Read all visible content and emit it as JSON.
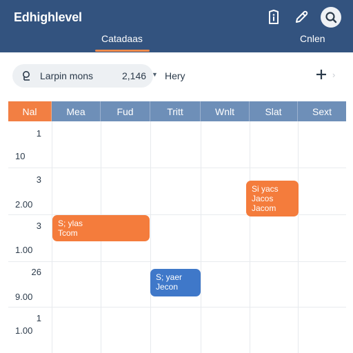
{
  "app": {
    "title": "Edhighlevel"
  },
  "header": {
    "tabs": [
      {
        "label": "Catadaas",
        "active": true
      },
      {
        "label": "Cnlen",
        "active": false
      }
    ],
    "icons": [
      "info-icon",
      "pencil-icon",
      "search-icon"
    ]
  },
  "toolbar": {
    "filter_label": "Larpin mons",
    "filter_count": "2,146",
    "link_label": "Hery"
  },
  "calendar": {
    "columns": [
      "Nal",
      "Mea",
      "Fud",
      "Tritt",
      "Wnlt",
      "Slat",
      "Sext"
    ],
    "time_labels": [
      {
        "top": "1",
        "bottom": "10"
      },
      {
        "top": "3",
        "bottom": "2.00"
      },
      {
        "top": "3",
        "bottom": "1.00"
      },
      {
        "top": "26",
        "bottom": "9.00"
      },
      {
        "top": "1",
        "bottom": "1.00"
      }
    ],
    "events": [
      {
        "line1": "Si yacs",
        "line2": "Jacos",
        "line3": "Jacom",
        "day": "Slat",
        "color": "#f47c3c"
      },
      {
        "line1": "S; ylas",
        "line2": "Tcom",
        "day": "Mea",
        "color": "#f47c3c"
      },
      {
        "line1": "S; yaer",
        "line2": "Jecon",
        "day": "Tritt",
        "color": "#3f78c9"
      }
    ]
  },
  "colors": {
    "header_bg": "#33537f",
    "accent": "#f47c3c",
    "column_header": "#6e8fb8",
    "event_blue": "#3f78c9"
  }
}
